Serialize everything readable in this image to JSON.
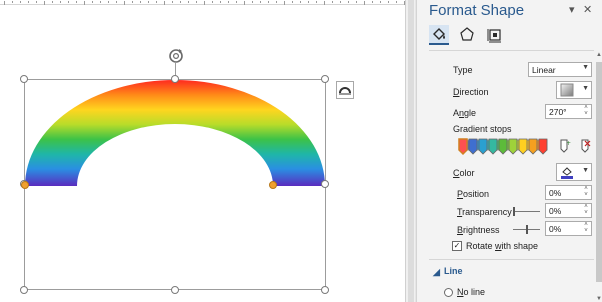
{
  "pane": {
    "title": "Format Shape",
    "tabs": [
      {
        "name": "fill-line",
        "icon": "paint-bucket-icon",
        "active": true
      },
      {
        "name": "effects",
        "icon": "pentagon-icon",
        "active": false
      },
      {
        "name": "size-properties",
        "icon": "size-properties-icon",
        "active": false
      }
    ],
    "type_label": "Type",
    "type_value": "Linear",
    "direction_label": "Direction",
    "angle_label": "Angle",
    "angle_value": "270°",
    "gradient_stops_label": "Gradient stops",
    "gradient_stop_colors": [
      "#ff5050",
      "#3f6fcf",
      "#2aa0d0",
      "#35b8a0",
      "#5dbb3a",
      "#9fd23a",
      "#ffd020",
      "#f5a020",
      "#ff4030"
    ],
    "color_label": "Color",
    "color_swatch": "#4040c0",
    "position_label": "Position",
    "position_value": "0%",
    "transparency_label": "Transparency",
    "transparency_value": "0%",
    "brightness_label": "Brightness",
    "brightness_value": "0%",
    "rotate_with_shape_label": "Rotate with shape",
    "rotate_with_shape_checked": true,
    "line_section_label": "Line",
    "no_line_label": "No line"
  },
  "shape": {
    "gradient_colors": [
      "#ff3a20",
      "#ff8c1a",
      "#ffd21f",
      "#b5dc2a",
      "#3dc24a",
      "#1fb5a5",
      "#2a8fe0",
      "#3a4cd0",
      "#5a2fbf"
    ]
  }
}
